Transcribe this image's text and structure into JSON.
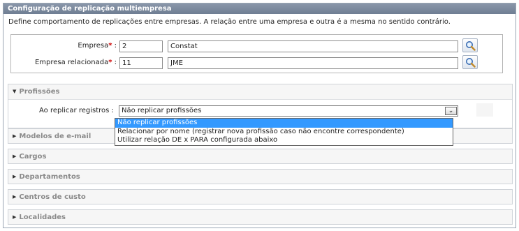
{
  "panel": {
    "title": "Configuração de replicação multiempresa",
    "description": "Define comportamento de replicações entre empresas. A relação entre uma empresa e outra é a mesma no sentido contrário."
  },
  "fields": {
    "empresa": {
      "label": "Empresa",
      "required_mark": "*",
      "colon": " :",
      "code": "2",
      "name": "Constat"
    },
    "relacionada": {
      "label": "Empresa relacionada",
      "required_mark": "*",
      "colon": " :",
      "code": "11",
      "name": "JME"
    }
  },
  "profissoes": {
    "title": "Profissões",
    "replicate_label": "Ao replicar registros :",
    "selected": "Não replicar profissões",
    "options": [
      "Não replicar profissões",
      "Relacionar por nome (registrar nova profissão caso não encontre correspondente)",
      "Utilizar relação DE x PARA configurada abaixo"
    ]
  },
  "sections": [
    {
      "title": "Modelos de e-mail"
    },
    {
      "title": "Cargos"
    },
    {
      "title": "Departamentos"
    },
    {
      "title": "Centros de custo"
    },
    {
      "title": "Localidades"
    }
  ],
  "colors": {
    "title_bar": "#7b889c",
    "required": "#cc0000",
    "selected_option": "#3399ff"
  },
  "icons": {
    "lookup": "magnifier-icon",
    "expanded": "triangle-down-icon",
    "collapsed": "triangle-right-icon"
  }
}
